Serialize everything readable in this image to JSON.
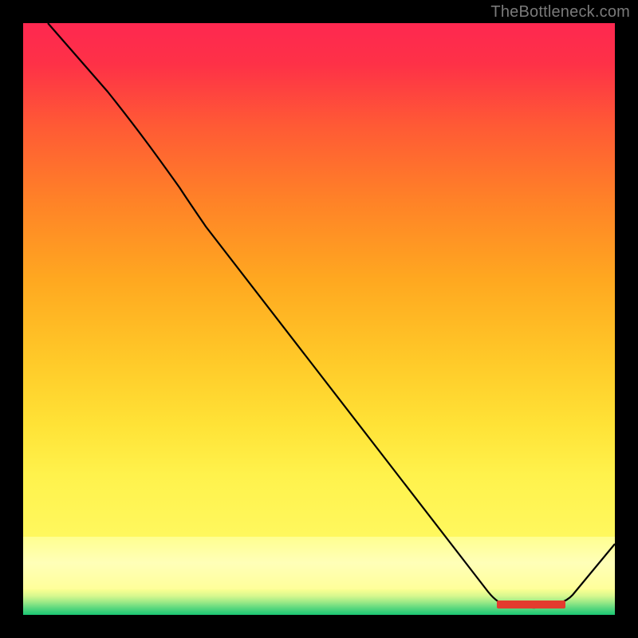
{
  "watermark": "TheBottleneck.com",
  "chart_data": {
    "type": "line",
    "title": "",
    "xlabel": "",
    "ylabel": "",
    "xlim": [
      0,
      100
    ],
    "ylim": [
      0,
      100
    ],
    "x": [
      4,
      14,
      26,
      31,
      79,
      86,
      90,
      97,
      100
    ],
    "values": [
      100,
      88,
      73,
      68,
      4,
      1.2,
      1.2,
      2.7,
      12
    ],
    "background_palette": {
      "top": "#fe2850",
      "mid_upper": "#ff8327",
      "mid": "#ffe236",
      "pale_band": "#ffffb8",
      "bottom": "#1ac774"
    },
    "optimal_zone_x": [
      80,
      92
    ],
    "marker_color": "#e33b2e"
  }
}
